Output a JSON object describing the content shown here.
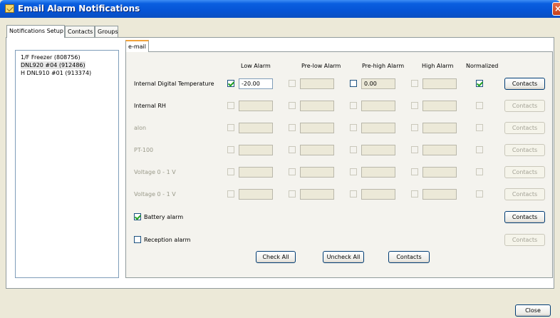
{
  "window": {
    "title": "Email Alarm Notifications",
    "close_glyph": "×"
  },
  "tabs": [
    "Notifications Setup",
    "Contacts",
    "Groups"
  ],
  "tree": [
    "1/F Freezer (808756)",
    "DNL920 #04 (912486)",
    "H DNL910 #01 (913374)"
  ],
  "subtab": "e-mail",
  "columns": [
    "Low Alarm",
    "Pre-low Alarm",
    "Pre-high Alarm",
    "High Alarm",
    "Normalized"
  ],
  "rows": [
    {
      "label": "Internal Digital Temperature",
      "low_checked": true,
      "low_value": "-20.00",
      "prehigh_checked": false,
      "prehigh_value": "0.00",
      "normalized_checked": true,
      "contacts": "Contacts"
    },
    {
      "label": "Internal RH",
      "contacts": "Contacts"
    },
    {
      "label": "alon",
      "contacts": "Contacts"
    },
    {
      "label": "PT-100",
      "contacts": "Contacts"
    },
    {
      "label": "Voltage 0 - 1 V",
      "contacts": "Contacts"
    },
    {
      "label": "Voltage 0 - 1 V",
      "contacts": "Contacts"
    }
  ],
  "battery_alarm": {
    "label": "Battery alarm",
    "checked": true,
    "contacts": "Contacts"
  },
  "reception_alarm": {
    "label": "Reception alarm",
    "checked": false,
    "contacts": "Contacts"
  },
  "buttons": {
    "check_all": "Check All",
    "uncheck_all": "Uncheck All",
    "contacts": "Contacts",
    "close": "Close"
  },
  "colors": {
    "titlebar": "#0554d6",
    "checkmark": "#21a121",
    "selected_tab_accent": "#f1a23a"
  }
}
